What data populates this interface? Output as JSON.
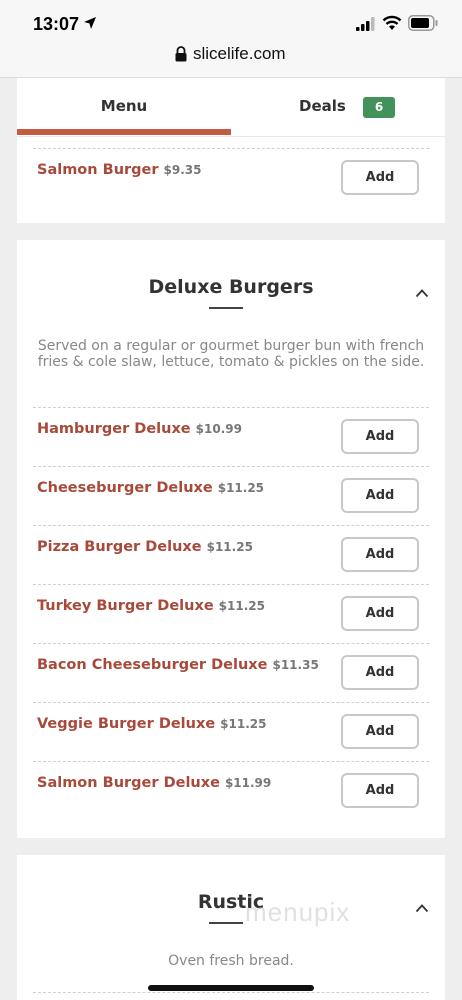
{
  "status_bar": {
    "time": "13:07"
  },
  "browser": {
    "url": "slicelife.com"
  },
  "tabs": {
    "menu_label": "Menu",
    "deals_label": "Deals",
    "deals_count": "6"
  },
  "top_section": {
    "items": [
      {
        "name": "Salmon Burger",
        "price": "$9.35",
        "button": "Add"
      }
    ]
  },
  "deluxe": {
    "title": "Deluxe Burgers",
    "description": "Served on a regular or gourmet burger bun with french fries & cole slaw, lettuce, tomato & pickles on the side.",
    "items": [
      {
        "name": "Hamburger Deluxe",
        "price": "$10.99",
        "button": "Add"
      },
      {
        "name": "Cheeseburger Deluxe",
        "price": "$11.25",
        "button": "Add"
      },
      {
        "name": "Pizza Burger Deluxe",
        "price": "$11.25",
        "button": "Add"
      },
      {
        "name": "Turkey Burger Deluxe",
        "price": "$11.25",
        "button": "Add"
      },
      {
        "name": "Bacon Cheeseburger Deluxe",
        "price": "$11.35",
        "button": "Add"
      },
      {
        "name": "Veggie Burger Deluxe",
        "price": "$11.25",
        "button": "Add"
      },
      {
        "name": "Salmon Burger Deluxe",
        "price": "$11.99",
        "button": "Add"
      }
    ]
  },
  "rustic": {
    "title": "Rustic",
    "description": "Oven fresh bread.",
    "watermark": "menupix"
  },
  "colors": {
    "accent": "#c55a43",
    "item_name": "#a84a3b",
    "badge": "#43915b"
  }
}
